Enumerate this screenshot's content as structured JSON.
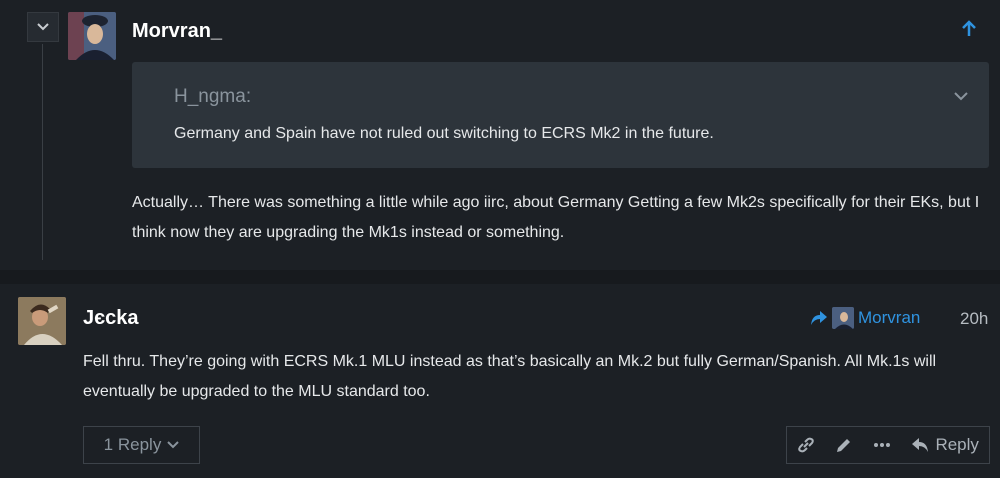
{
  "comment1": {
    "username": "Morvran_",
    "quote": {
      "author": "H_ngma:",
      "text": "Germany and Spain have not ruled out switching to ECRS Mk2 in the future."
    },
    "body": "Actually… There was something a little while ago iirc, about Germany Getting a few Mk2s specifically for their EKs, but I think now they are upgrading the Mk1s instead or something."
  },
  "comment2": {
    "username": "Jєcka",
    "reply_to": "Morvran",
    "timestamp": "20h",
    "body": "Fell thru. They’re going with ECRS Mk.1 MLU instead as that’s basically an Mk.2 but fully German/Spanish. All Mk.1s will eventually be upgraded to the MLU standard too.",
    "replies_label": "1 Reply",
    "reply_label": "Reply"
  },
  "icons": [
    "chevron-down-icon",
    "arrow-up-icon",
    "share-reply-icon",
    "link-icon",
    "pencil-icon",
    "more-icon",
    "reply-icon"
  ],
  "colors": {
    "background": "#1c2025",
    "accent": "#2f93e0",
    "quote_bg": "#2d343b",
    "muted": "#8a949d"
  }
}
